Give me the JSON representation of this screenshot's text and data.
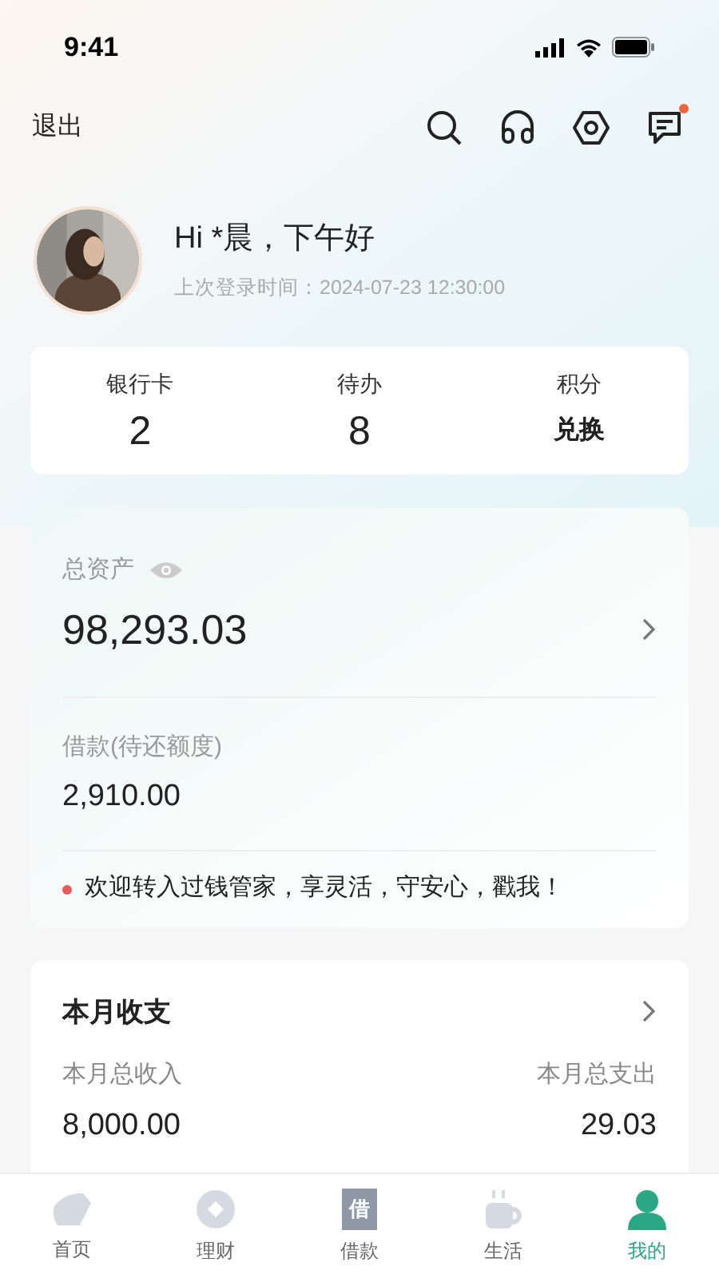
{
  "status_bar": {
    "time": "9:41"
  },
  "header": {
    "logout": "退出",
    "notification_badge": true
  },
  "profile": {
    "greeting": "Hi *晨，下午好",
    "last_login": "上次登录时间：2024-07-23 12:30:00"
  },
  "stats": [
    {
      "label": "银行卡",
      "value": "2"
    },
    {
      "label": "待办",
      "value": "8"
    },
    {
      "label": "积分",
      "value": "兑换"
    }
  ],
  "assets": {
    "total_label": "总资产",
    "total_value": "98,293.03",
    "loan_label": "借款(待还额度)",
    "loan_value": "2,910.00",
    "notice": "欢迎转入过钱管家，享灵活，守安心，戳我！"
  },
  "monthly": {
    "title": "本月收支",
    "income_label": "本月总收入",
    "income_value": "8,000.00",
    "expense_label": "本月总支出",
    "expense_value": "29.03"
  },
  "tabs": [
    {
      "kind": "home",
      "label": "首页",
      "selected": false
    },
    {
      "kind": "finance",
      "label": "理财",
      "selected": false
    },
    {
      "kind": "loan",
      "label": "借款",
      "icon_text": "借",
      "selected": false
    },
    {
      "kind": "life",
      "label": "生活",
      "selected": false
    },
    {
      "kind": "me",
      "label": "我的",
      "selected": true
    }
  ]
}
